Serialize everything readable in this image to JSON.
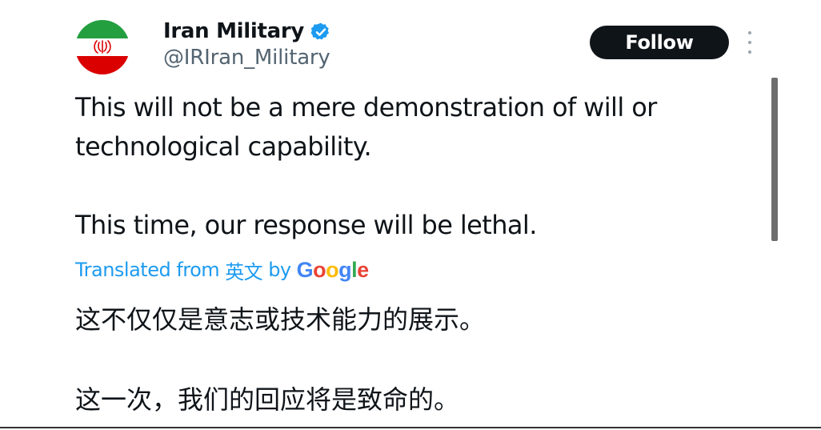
{
  "tweet": {
    "author": {
      "display_name": "Iran Military",
      "handle": "@IRIran_Military",
      "verified_icon": "verified-badge-icon",
      "avatar_icon": "iran-flag-avatar"
    },
    "follow_label": "Follow",
    "more_icon": "more-options-icon",
    "text": {
      "line1": "This will not be a mere demonstration of will or technological capability.",
      "line2": "This time, our response will be lethal."
    },
    "translation": {
      "label_prefix": "Translated from",
      "source_language": "英文",
      "label_by": "by",
      "provider_letters": [
        "G",
        "o",
        "o",
        "g",
        "l",
        "e"
      ],
      "line1": "这不仅仅是意志或技术能力的展示。",
      "line2": "这一次，我们的回应将是致命的。"
    }
  },
  "colors": {
    "text_primary": "#0f1419",
    "text_secondary": "#536471",
    "link_blue": "#1d9bf0",
    "verified_blue": "#1d9bf0",
    "follow_bg": "#0f1419",
    "flag_green": "#239f40",
    "flag_red": "#da0000"
  }
}
